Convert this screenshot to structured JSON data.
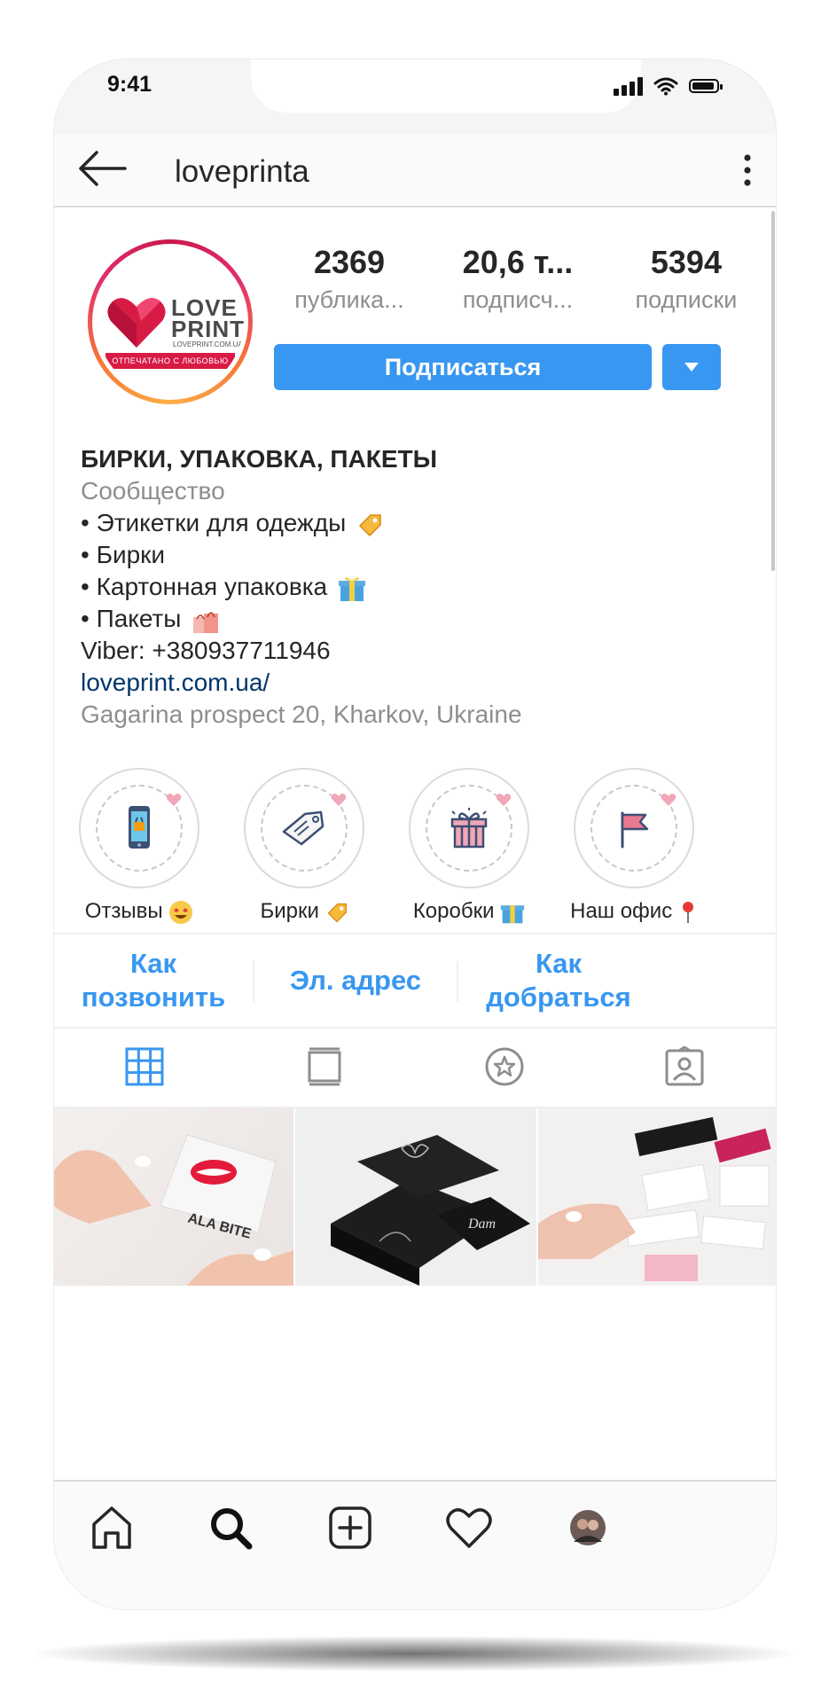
{
  "status_bar": {
    "time": "9:41"
  },
  "header": {
    "username": "loveprinta"
  },
  "avatar": {
    "logo_line1": "LOVE",
    "logo_line2": "PRINT",
    "logo_url": "LOVEPRINT.COM.UA",
    "logo_tagline": "ОТПЕЧАТАНО С ЛЮБОВЬЮ"
  },
  "stats": [
    {
      "value": "2369",
      "label": "публика..."
    },
    {
      "value": "20,6 т...",
      "label": "подписч..."
    },
    {
      "value": "5394",
      "label": "подписки"
    }
  ],
  "follow_button": {
    "label": "Подписаться"
  },
  "bio": {
    "name": "БИРКИ, УПАКОВКА, ПАКЕТЫ",
    "category": "Сообщество",
    "lines": [
      "• Этикетки для одежды",
      "• Бирки",
      "• Картонная упаковка",
      "• Пакеты"
    ],
    "phone": "Viber: +380937711946",
    "link": "loveprint.com.ua/",
    "address": "Gagarina prospect 20, Kharkov, Ukraine"
  },
  "highlights": [
    {
      "label": "Отзывы",
      "icon": "phone-basket-icon"
    },
    {
      "label": "Бирки",
      "icon": "tag-icon"
    },
    {
      "label": "Коробки",
      "icon": "gift-icon"
    },
    {
      "label": "Наш офис",
      "icon": "flag-icon"
    }
  ],
  "actions": [
    {
      "line1": "Как",
      "line2": "позвонить"
    },
    {
      "line1": "Эл. адрес",
      "line2": ""
    },
    {
      "line1": "Как",
      "line2": "добраться"
    }
  ],
  "tabs": [
    "grid-icon",
    "feed-icon",
    "star-icon",
    "tagged-icon"
  ],
  "colors": {
    "accent": "#3897f0",
    "text": "#262626",
    "muted": "#8e8e8e",
    "link": "#003569",
    "brand_red": "#d81b45"
  },
  "bottom_nav": [
    "home-icon",
    "search-icon",
    "add-icon",
    "heart-icon",
    "profile-avatar"
  ]
}
